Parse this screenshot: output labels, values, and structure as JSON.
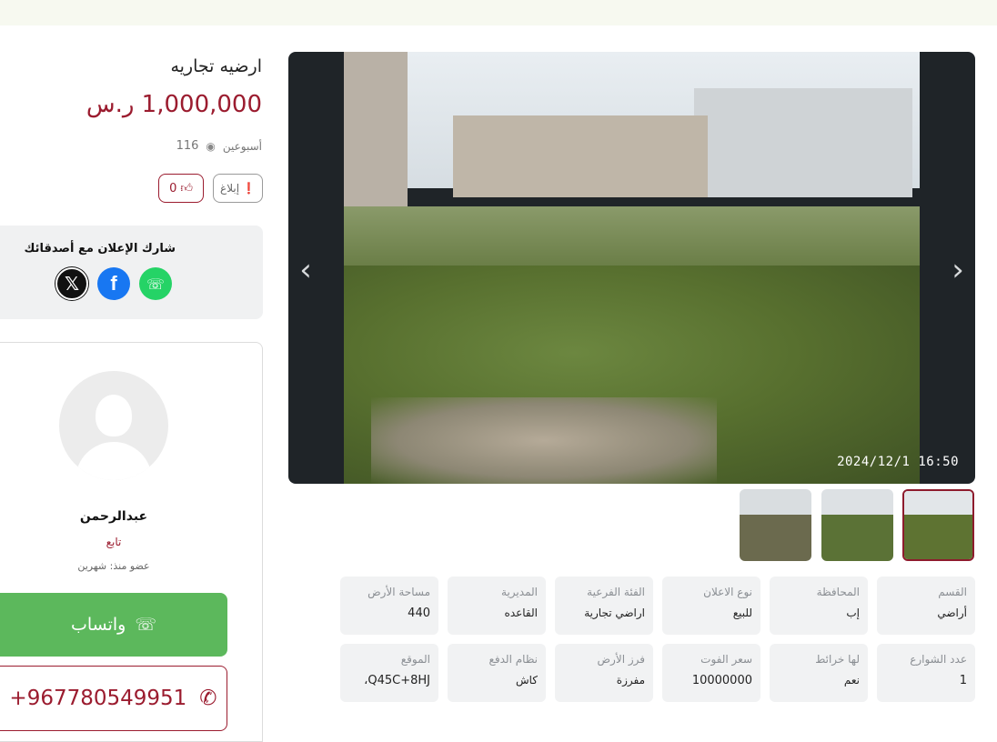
{
  "listing": {
    "title": "ارضيه تجاريه",
    "price": "1,000,000 ر.س",
    "posted": "أسبوعين",
    "views": "116",
    "report_label": "إبلاغ",
    "likes": "0"
  },
  "gallery": {
    "timestamp": "2024/12/1  16:50",
    "prev_icon": "chevron-left-icon",
    "next_icon": "chevron-right-icon",
    "thumbnail_count": 3
  },
  "share": {
    "title": "شارك الإعلان مع أصدقائك",
    "networks": [
      "x",
      "facebook",
      "whatsapp"
    ]
  },
  "seller": {
    "name": "عبدالرحمن",
    "role": "تابع",
    "member_since": "عضو منذ: شهرين"
  },
  "contact": {
    "whatsapp_label": "واتساب",
    "phone": "+967780549951"
  },
  "details": [
    {
      "key": "القسم",
      "value": "أراضي"
    },
    {
      "key": "المحافظة",
      "value": "إب"
    },
    {
      "key": "نوع الاعلان",
      "value": "للبيع"
    },
    {
      "key": "الفئة الفرعية",
      "value": "اراضي تجارية"
    },
    {
      "key": "المديرية",
      "value": "القاعده"
    },
    {
      "key": "مساحة الأرض",
      "value": "440"
    },
    {
      "key": "عدد الشوارع",
      "value": "1"
    },
    {
      "key": "لها خرائط",
      "value": "نعم"
    },
    {
      "key": "سعر الفوت",
      "value": "10000000"
    },
    {
      "key": "فرز الأرض",
      "value": "مفرزة"
    },
    {
      "key": "نظام الدفع",
      "value": "كاش"
    },
    {
      "key": "الموقع",
      "value": "Q45C+8HJ،"
    }
  ],
  "colors": {
    "accent": "#9b1c2f",
    "whatsapp": "#5cb85c",
    "card_bg": "#f1f2f3"
  }
}
